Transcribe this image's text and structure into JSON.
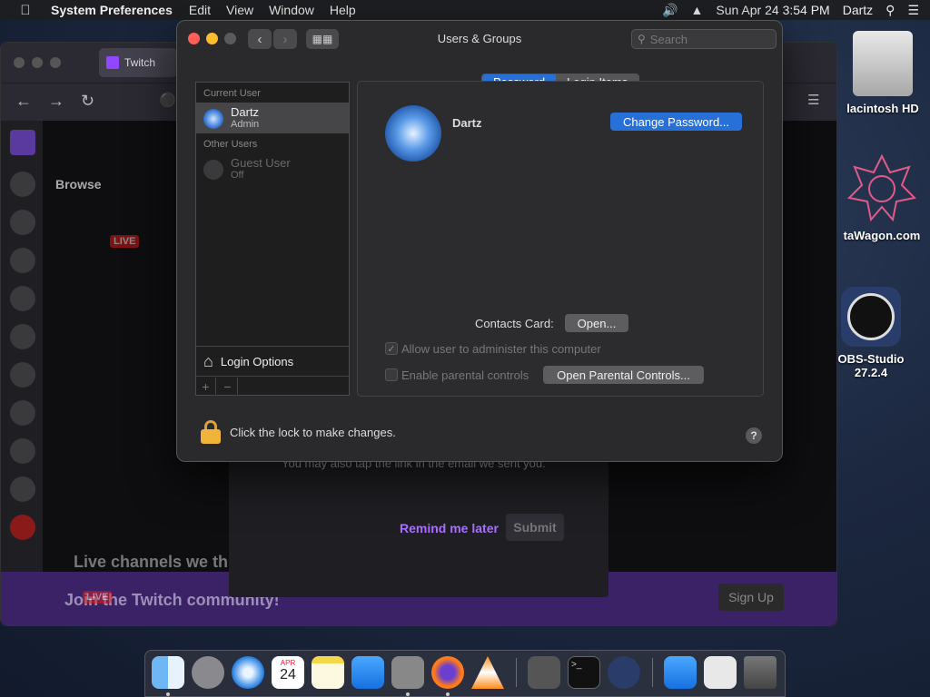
{
  "menubar": {
    "app_name": "System Preferences",
    "menus": [
      "Edit",
      "View",
      "Window",
      "Help"
    ],
    "datetime": "Sun Apr 24  3:54 PM",
    "user": "Dartz"
  },
  "browser": {
    "tab_title": "Twitch",
    "browse": "Browse",
    "live": "LIVE",
    "live2": "LIVE",
    "channels_heading": "Live channels we thi",
    "banner_text": "Join the Twitch community!",
    "signup": "Sign Up"
  },
  "modal": {
    "text": "You may also tap the link in the email we sent you.",
    "remind": "Remind me later",
    "submit": "Submit"
  },
  "desktop": {
    "hd_label": "lacintosh HD",
    "dw_label": "taWagon.com",
    "obs_label1": "OBS-Studio",
    "obs_label2": "27.2.4"
  },
  "dialog": {
    "title": "Users & Groups",
    "search_placeholder": "Search",
    "current_user_header": "Current User",
    "current_user": {
      "name": "Dartz",
      "role": "Admin"
    },
    "other_users_header": "Other Users",
    "guest_user": {
      "name": "Guest User",
      "status": "Off"
    },
    "login_options": "Login Options",
    "tabs": {
      "password": "Password",
      "login_items": "Login Items"
    },
    "selected_name": "Dartz",
    "change_password": "Change Password...",
    "contacts_card_label": "Contacts Card:",
    "open_button": "Open...",
    "allow_admin": "Allow user to administer this computer",
    "enable_parental": "Enable parental controls",
    "open_parental": "Open Parental Controls...",
    "lock_text": "Click the lock to make changes.",
    "help": "?"
  },
  "dock": {
    "calendar_month": "APR",
    "calendar_day": "24"
  },
  "colors": {
    "accent": "#2670d8",
    "twitch": "#9146ff"
  }
}
